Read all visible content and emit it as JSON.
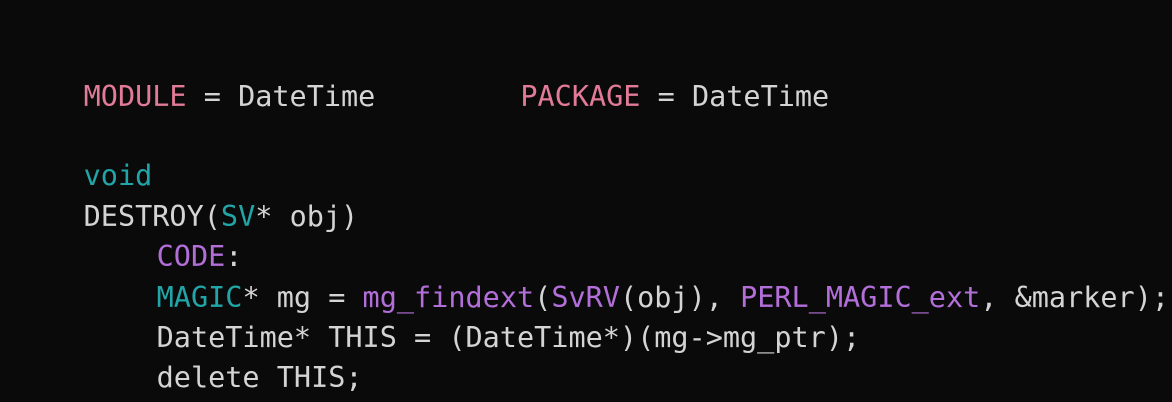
{
  "colors": {
    "background": "#0b0a0b",
    "text": "#d4d4d4",
    "pink": "#e27b98",
    "teal": "#22a5a6",
    "purple": "#b36fd9"
  },
  "line1": {
    "module_key": "MODULE",
    "module_eq": " = ",
    "module_val": "DateTime",
    "package_key": "PACKAGE",
    "package_eq": " = ",
    "package_val": "DateTime"
  },
  "line3": {
    "type": "void"
  },
  "line4": {
    "func": "DESTROY(",
    "type": "SV",
    "rest": "* obj)"
  },
  "line5": {
    "label": "CODE",
    "colon": ":"
  },
  "line6": {
    "type": "MAGIC",
    "decl": "* mg = ",
    "fn": "mg_findext",
    "paren": "(",
    "macro": "SvRV",
    "arg": "(obj), ",
    "const": "PERL_MAGIC_ext",
    "tail": ", &marker);"
  },
  "line7": {
    "text": "DateTime* THIS = (DateTime*)(mg->mg_ptr);"
  },
  "line8": {
    "text": "delete THIS;"
  }
}
